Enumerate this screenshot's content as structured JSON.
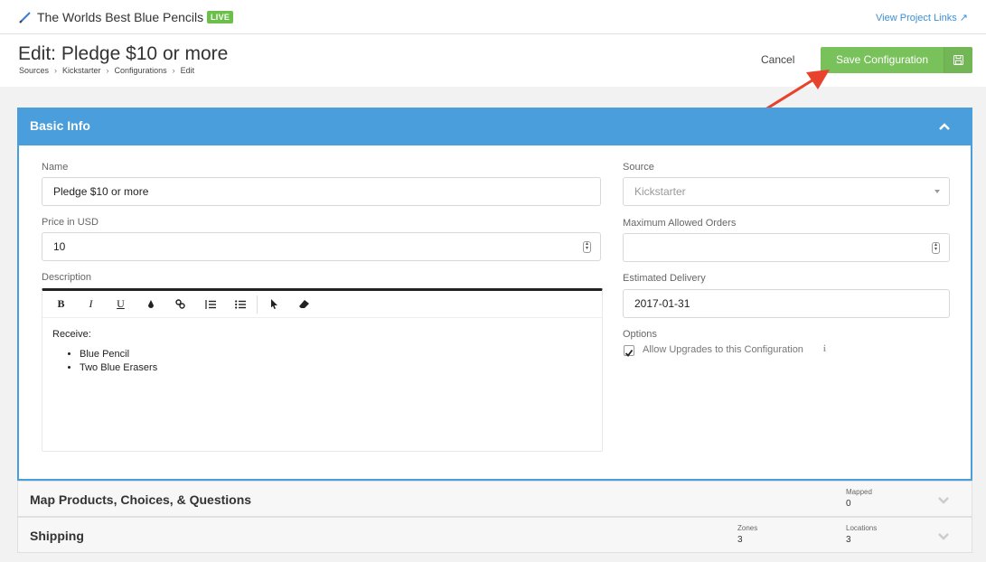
{
  "project": {
    "title": "The Worlds Best Blue Pencils",
    "status": "LIVE",
    "links_label": "View Project Links ↗"
  },
  "header": {
    "title": "Edit: Pledge $10 or more",
    "breadcrumb": [
      "Sources",
      "Kickstarter",
      "Configurations",
      "Edit"
    ],
    "cancel_label": "Cancel",
    "save_label": "Save Configuration"
  },
  "basic_info": {
    "title": "Basic Info",
    "name_label": "Name",
    "name_value": "Pledge $10 or more",
    "price_label": "Price in USD",
    "price_value": "10",
    "description_label": "Description",
    "description": {
      "intro": "Receive:",
      "items": [
        "Blue Pencil",
        "Two Blue Erasers"
      ]
    },
    "toolbar": {
      "bold": "B",
      "italic": "I",
      "underline": "U"
    },
    "source_label": "Source",
    "source_value": "Kickstarter",
    "max_orders_label": "Maximum Allowed Orders",
    "max_orders_value": "",
    "delivery_label": "Estimated Delivery",
    "delivery_value": "2017-01-31",
    "options_label": "Options",
    "allow_upgrades_label": "Allow Upgrades to this Configuration",
    "allow_upgrades_checked": true,
    "info_glyph": "i"
  },
  "sections": {
    "map": {
      "title": "Map Products, Choices, & Questions",
      "mapped_label": "Mapped",
      "mapped_value": "0"
    },
    "shipping": {
      "title": "Shipping",
      "zones_label": "Zones",
      "zones_value": "3",
      "locations_label": "Locations",
      "locations_value": "3"
    }
  },
  "colors": {
    "accent": "#4a9edb",
    "save": "#79c15b",
    "live": "#6cc04a",
    "link": "#3a8fd6",
    "annotation_arrow": "#e8412c"
  }
}
